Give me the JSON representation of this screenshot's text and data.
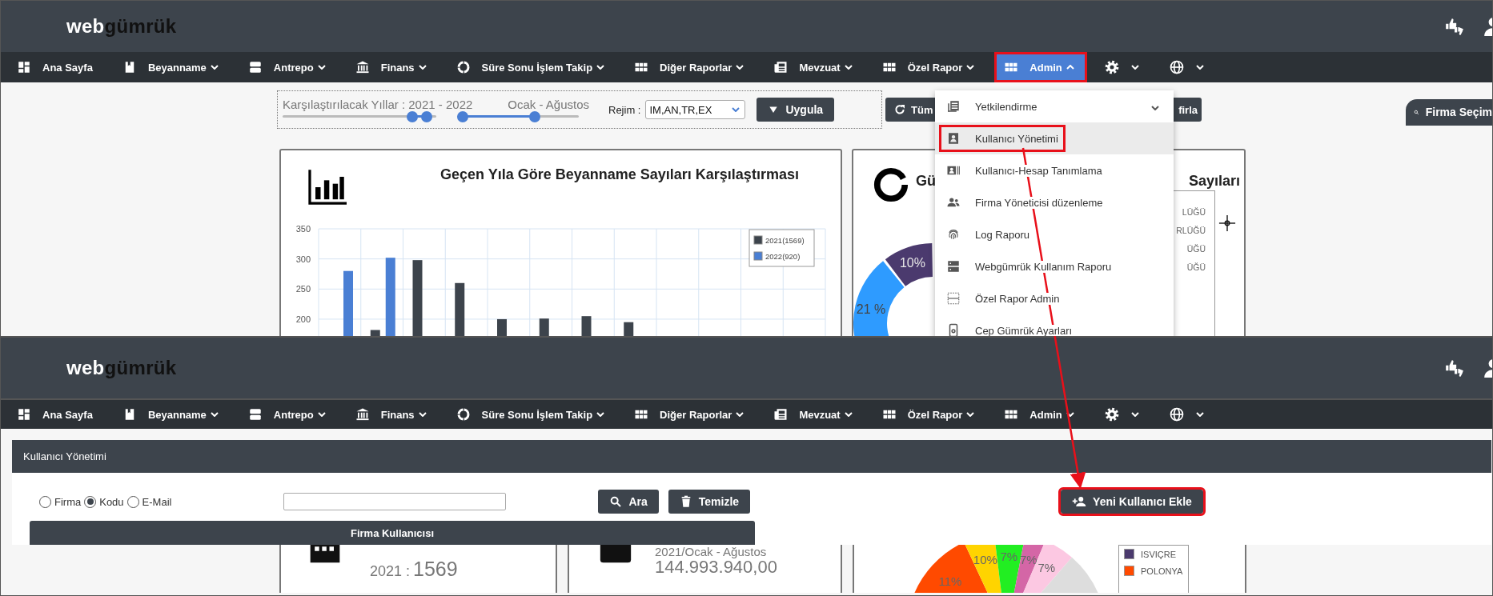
{
  "top_screen": {
    "header": {
      "logo_light": "web",
      "logo_dark": "gümrük"
    },
    "nav": [
      {
        "kind": "link",
        "label": "Ana Sayfa",
        "selected": false,
        "highlighted": false
      },
      {
        "kind": "menu",
        "label": "Beyanname",
        "selected": false,
        "expanded": false,
        "highlighted": false
      },
      {
        "kind": "menu",
        "label": "Antrepo",
        "selected": false,
        "expanded": false,
        "highlighted": false
      },
      {
        "kind": "menu",
        "label": "Finans",
        "selected": false,
        "expanded": false,
        "highlighted": false
      },
      {
        "kind": "menu",
        "label": "Süre Sonu İşlem Takip",
        "selected": false,
        "expanded": false,
        "highlighted": false
      },
      {
        "kind": "menu",
        "label": "Diğer Raporlar",
        "selected": false,
        "expanded": false,
        "highlighted": false
      },
      {
        "kind": "menu",
        "label": "Mevzuat",
        "selected": false,
        "expanded": false,
        "highlighted": false
      },
      {
        "kind": "menu",
        "label": "Özel Rapor",
        "selected": false,
        "expanded": false,
        "highlighted": false
      },
      {
        "kind": "menu",
        "label": "Admin",
        "selected": true,
        "expanded": true,
        "highlighted": true
      },
      {
        "kind": "icon-menu",
        "selected": false,
        "expanded": false,
        "highlighted": false
      },
      {
        "kind": "icon-menu",
        "selected": false,
        "expanded": false,
        "highlighted": false
      }
    ],
    "filters": {
      "years_label": "Karşılaştırılacak Yıllar : 2021 - 2022",
      "months_label": "Ocak - Ağustos",
      "year_slider": [
        {
          "level": 0.87
        },
        {
          "level": 0.97
        }
      ],
      "month_slider": [
        {
          "level": 0.0
        },
        {
          "level": 0.65
        }
      ],
      "regime_label": "Rejim :",
      "regime_value": "IM,AN,TR,EX",
      "apply_button": "Uygula",
      "reset_button_left": "Tüm",
      "reset_button_right": "firla"
    },
    "company_tab": "Firma Seçim",
    "bar_card": {
      "title": "Geçen Yıla Göre Beyanname Sayıları Karşılaştırması",
      "chart_data": {
        "type": "bar",
        "stacked": false,
        "grid": true,
        "legend": true,
        "ylim": [
          172,
          350
        ],
        "yticks": [
          200,
          250,
          300,
          350
        ],
        "series": [
          {
            "name": "2021(1569)",
            "color": "#3d444c",
            "values": [
              null,
              182,
              298,
              260,
              200,
              201,
              205,
              195,
              null,
              null,
              null,
              null
            ]
          },
          {
            "name": "2022(920)",
            "color": "#4a7fd4",
            "values": [
              280,
              302,
              null,
              null,
              null,
              null,
              null,
              null,
              null,
              null,
              null,
              null
            ]
          }
        ]
      }
    },
    "donut_card": {
      "title_start": "Gü",
      "title_end": "Sayıları",
      "slices": [
        {
          "label": "21 %",
          "color": "#2e9bff"
        },
        {
          "label": "10%",
          "color": "#4b3a6e"
        }
      ],
      "legend_fragments": [
        "LÜĞÜ",
        "RLÜĞÜ",
        "ÜĞÜ",
        "ÜĞÜ"
      ]
    },
    "admin_menu": [
      {
        "kind": "submenu",
        "label": "Yetkilendirme",
        "selected": false,
        "highlighted": false
      },
      {
        "kind": "item",
        "label": "Kullanıcı Yönetimi",
        "selected": true,
        "highlighted": true
      },
      {
        "kind": "item",
        "label": "Kullanıcı-Hesap Tanımlama",
        "selected": false,
        "highlighted": false
      },
      {
        "kind": "item",
        "label": "Firma Yöneticisi düzenleme",
        "selected": false,
        "highlighted": false
      },
      {
        "kind": "item",
        "label": "Log Raporu",
        "selected": false,
        "highlighted": false
      },
      {
        "kind": "item",
        "label": "Webgümrük Kullanım Raporu",
        "selected": false,
        "highlighted": false
      },
      {
        "kind": "item",
        "label": "Özel Rapor Admin",
        "selected": false,
        "highlighted": false
      },
      {
        "kind": "item",
        "label": "Cep Gümrük Ayarları",
        "selected": false,
        "highlighted": false
      }
    ]
  },
  "bottom_screen": {
    "header": {
      "logo_light": "web",
      "logo_dark": "gümrük"
    },
    "nav": [
      {
        "kind": "link",
        "label": "Ana Sayfa",
        "selected": false,
        "highlighted": false
      },
      {
        "kind": "menu",
        "label": "Beyanname",
        "selected": false,
        "expanded": false,
        "highlighted": false
      },
      {
        "kind": "menu",
        "label": "Antrepo",
        "selected": false,
        "expanded": false,
        "highlighted": false
      },
      {
        "kind": "menu",
        "label": "Finans",
        "selected": false,
        "expanded": false,
        "highlighted": false
      },
      {
        "kind": "menu",
        "label": "Süre Sonu İşlem Takip",
        "selected": false,
        "expanded": false,
        "highlighted": false
      },
      {
        "kind": "menu",
        "label": "Diğer Raporlar",
        "selected": false,
        "expanded": false,
        "highlighted": false
      },
      {
        "kind": "menu",
        "label": "Mevzuat",
        "selected": false,
        "expanded": false,
        "highlighted": false
      },
      {
        "kind": "menu",
        "label": "Özel Rapor",
        "selected": false,
        "expanded": false,
        "highlighted": false
      },
      {
        "kind": "menu",
        "label": "Admin",
        "selected": false,
        "expanded": false,
        "highlighted": false
      },
      {
        "kind": "icon-menu",
        "selected": false,
        "expanded": false,
        "highlighted": false
      },
      {
        "kind": "icon-menu",
        "selected": false,
        "expanded": false,
        "highlighted": false
      }
    ],
    "panel": {
      "title": "Kullanıcı Yönetimi",
      "search_by": [
        {
          "label": "Firma",
          "selected": false
        },
        {
          "label": "Kodu",
          "selected": true
        },
        {
          "label": "E-Mail",
          "selected": false
        }
      ],
      "buttons": [
        {
          "label": "Ara",
          "highlighted": false
        },
        {
          "label": "Temizle",
          "highlighted": false
        }
      ],
      "add_button": {
        "label": "Yeni Kullanıcı Ekle",
        "highlighted": true
      },
      "table_title": "Firma Kullanıcısı"
    },
    "count_card": {
      "year": "2021 :",
      "count": "1569"
    },
    "amount_card": {
      "period": "2021/Ocak - Ağustos",
      "amount": "144.993.940,00"
    },
    "pie_card": {
      "slices": [
        {
          "label": "11%",
          "color": "#ff4a00"
        },
        {
          "label": "10%",
          "color": "#ffd400"
        },
        {
          "label": "7%",
          "color": "#22ee22"
        },
        {
          "label": "7%",
          "color": "#d466a6"
        },
        {
          "label": "7%",
          "color": "#fcc8e2"
        },
        {
          "color": "#dddddd"
        }
      ],
      "legend": [
        {
          "label": "ISVIÇRE",
          "color": "#4b3a6e"
        },
        {
          "label": "POLONYA",
          "color": "#ff4a00"
        }
      ]
    }
  }
}
